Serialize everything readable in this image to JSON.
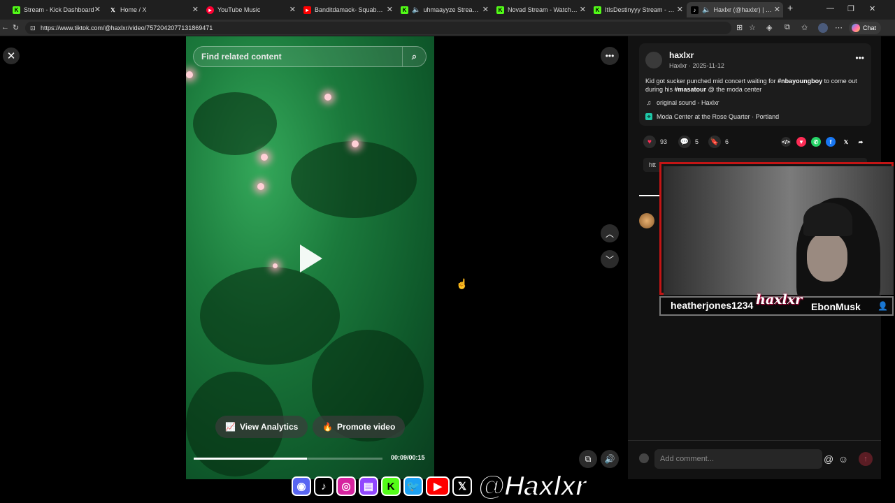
{
  "browser": {
    "tabs": [
      {
        "title": "Stream - Kick Dashboard",
        "icon": "kick-icon"
      },
      {
        "title": "Home / X",
        "icon": "x-icon"
      },
      {
        "title": "YouTube Music",
        "icon": "youtube-music-icon"
      },
      {
        "title": "Banditdamack- Squabble N",
        "icon": "youtube-icon"
      },
      {
        "title": "uhmaayyze Stream - Wa",
        "icon": "kick-icon"
      },
      {
        "title": "Novad Stream - Watch Live",
        "icon": "kick-icon"
      },
      {
        "title": "ItIsDestinyyy Stream - Watch",
        "icon": "kick-icon"
      },
      {
        "title": "Haxlxr (@haxlxr) | TikTo",
        "icon": "tiktok-icon"
      }
    ],
    "url": "https://www.tiktok.com/@haxlxr/video/7572042077131869471",
    "chat_label": "Chat"
  },
  "video": {
    "search_placeholder": "Find related content",
    "view_analytics_label": "View Analytics",
    "promote_label": "Promote video",
    "time": "00:09/00:15",
    "progress": 0.6
  },
  "post": {
    "username": "haxlxr",
    "subline": "Haxlxr · 2025-11-12",
    "caption_pre": "Kid got sucker punched mid concert waiting for ",
    "hashtag1": "#nbayoungboy",
    "caption_mid": " to come out during his ",
    "hashtag2": "#masatour",
    "caption_post": " @ the moda center",
    "sound": "original sound - Haxlxr",
    "location": "Moda Center at the Rose Quarter · Portland",
    "likes": "93",
    "comments": "5",
    "saves": "6",
    "link_prefix": "htt"
  },
  "overlay": {
    "viewer_name": "heatherjones1234",
    "script_handle": "haxlxr",
    "streamer_name": "EbonMusk",
    "social_handle": "@Haxlxr"
  },
  "comment": {
    "placeholder": "Add comment..."
  },
  "colors": {
    "accent_red": "#c31515",
    "tiktok_like": "#fe2c55",
    "video_green": "#1b7a3c"
  }
}
